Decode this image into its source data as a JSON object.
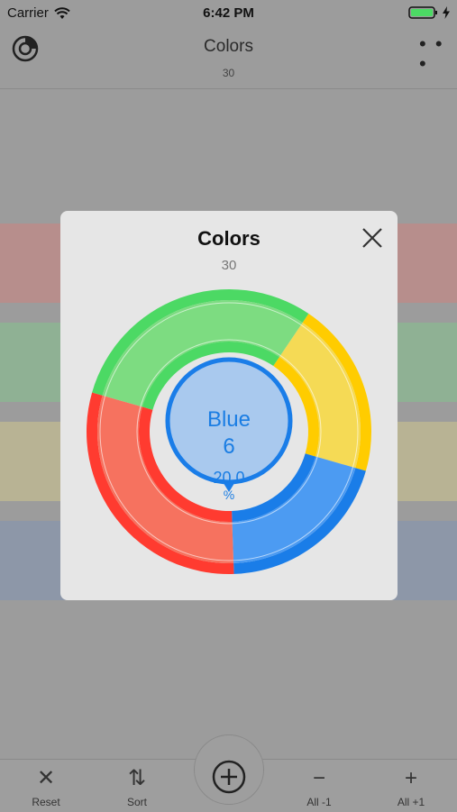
{
  "status": {
    "carrier": "Carrier",
    "time": "6:42 PM"
  },
  "nav": {
    "title": "Colors",
    "subtitle": "30",
    "more_label": "• • •"
  },
  "modal": {
    "title": "Colors",
    "count": "30",
    "selected": {
      "name": "Blue",
      "count": "6",
      "percent": "20.0",
      "percent_sign": "%"
    }
  },
  "chart_data": {
    "type": "pie",
    "start_angle_deg": -56,
    "slices": [
      {
        "name": "Yellow",
        "value": 6,
        "color": "#ffcc00",
        "fill": "#f5da55"
      },
      {
        "name": "Blue",
        "value": 6,
        "color": "#1a7de8",
        "fill": "#4c9bf2"
      },
      {
        "name": "Red",
        "value": 9,
        "color": "#ff3b30",
        "fill": "#f6725f"
      },
      {
        "name": "Green",
        "value": 9,
        "color": "#4cd964",
        "fill": "#7ddc81"
      }
    ]
  },
  "background_rows": [
    {
      "color": "#b78e8c"
    },
    {
      "color": "#8fb194"
    },
    {
      "color": "#b8b394"
    },
    {
      "color": "#8d97a8"
    }
  ],
  "toolbar": {
    "items": [
      {
        "label": "Reset",
        "icon": "✕"
      },
      {
        "label": "Sort",
        "icon": "⇅"
      },
      {
        "label": "All -1",
        "icon": "−"
      },
      {
        "label": "All +1",
        "icon": "+"
      }
    ]
  }
}
